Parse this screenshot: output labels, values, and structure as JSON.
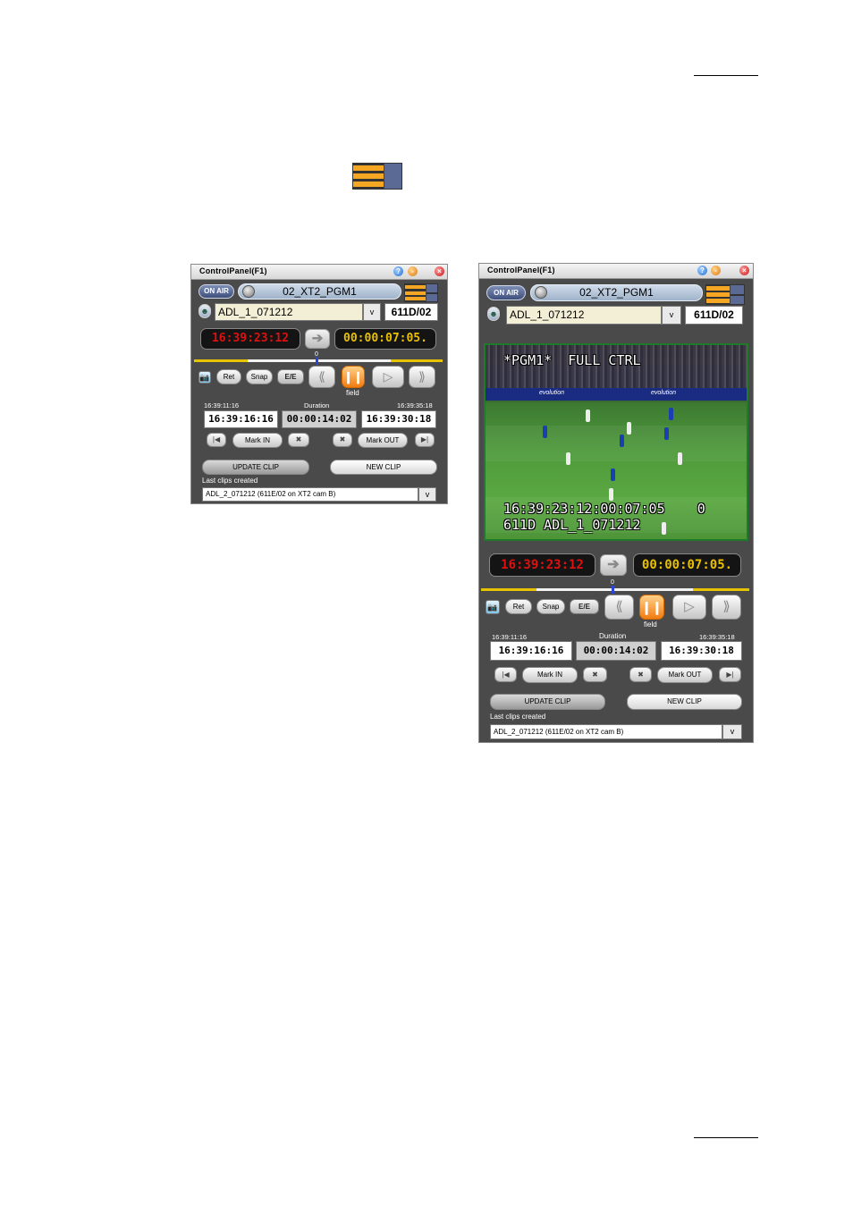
{
  "header_rule": true,
  "panels": [
    {
      "id": "compact",
      "title": "ControlPanel(F1)",
      "on_air": "ON AIR",
      "channel": "02_XT2_PGM1",
      "clip_name": "ADL_1_071212",
      "dropdown": "v",
      "clip_id": "611D/02",
      "tc_current": "16:39:23:12",
      "tc_remaining": "00:00:07:05.",
      "timeline_zero": "0",
      "buttons": {
        "ret": "Ret",
        "snap": "Snap",
        "ee": "E/E",
        "camera": "📷"
      },
      "field_label": "field",
      "in_small": "16:39:11:16",
      "duration_label": "Duration",
      "out_small": "16:39:35:18",
      "mark_in_tc": "16:39:16:16",
      "duration_tc": "00:00:14:02",
      "mark_out_tc": "16:39:30:18",
      "mark_in": "Mark IN",
      "mark_out": "Mark OUT",
      "update_clip": "UPDATE CLIP",
      "new_clip": "NEW CLIP",
      "last_clips_label": "Last clips created",
      "last_clip": "ADL_2_071212 (611E/02 on XT2 cam B)"
    },
    {
      "id": "expanded",
      "title": "ControlPanel(F1)",
      "on_air": "ON AIR",
      "channel": "02_XT2_PGM1",
      "clip_name": "ADL_1_071212",
      "dropdown": "v",
      "clip_id": "611D/02",
      "video_overlay_top": "*PGM1*  FULL CTRL",
      "video_overlay_tc": "16:39:23:12:00:07:05    0",
      "video_overlay_clip": "611D ADL_1_071212",
      "ad_board_1": "evolution",
      "ad_board_2": "evolution",
      "tc_current": "16:39:23:12",
      "tc_remaining": "00:00:07:05.",
      "timeline_zero": "0",
      "buttons": {
        "ret": "Ret",
        "snap": "Snap",
        "ee": "E/E",
        "camera": "📷"
      },
      "field_label": "field",
      "in_small": "16:39:11:16",
      "duration_label": "Duration",
      "out_small": "16:39:35:18",
      "mark_in_tc": "16:39:16:16",
      "duration_tc": "00:00:14:02",
      "mark_out_tc": "16:39:30:18",
      "mark_in": "Mark IN",
      "mark_out": "Mark OUT",
      "update_clip": "UPDATE CLIP",
      "new_clip": "NEW CLIP",
      "last_clips_label": "Last clips created",
      "last_clip": "ADL_2_071212 (611E/02 on XT2 cam B)"
    }
  ],
  "colors": {
    "accent_orange": "#f5a623",
    "pane_blue": "#5b6a94",
    "panel_bg": "#4a4a4a",
    "tc_red": "#e01010",
    "tc_yellow": "#e8c000"
  },
  "icons": {
    "layout_toggle": "layout-toggle-icon"
  }
}
